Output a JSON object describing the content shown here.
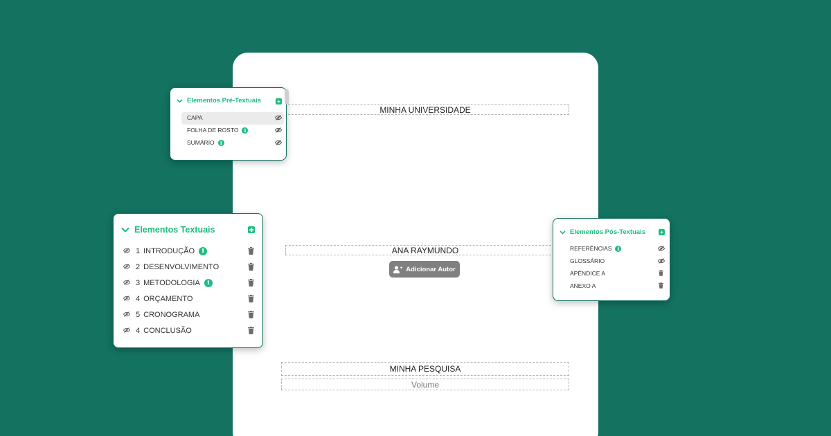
{
  "document": {
    "university": "MINHA UNIVERSIDADE",
    "author": "ANA RAYMUNDO",
    "add_author_label": "Adicionar Autor",
    "title": "MINHA PESQUISA",
    "volume_placeholder": "Volume"
  },
  "pre_textual": {
    "title": "Elementos Pré-Textuais",
    "items": [
      {
        "label": "CAPA",
        "info": false,
        "selected": true
      },
      {
        "label": "FOLHA DE ROSTO",
        "info": true
      },
      {
        "label": "SUMÁRIO",
        "info": true
      }
    ]
  },
  "textual": {
    "title": "Elementos Textuais",
    "items": [
      {
        "number": "1",
        "label": "INTRODUÇÃO",
        "info": true
      },
      {
        "number": "2",
        "label": "DESENVOLVIMENTO",
        "info": false
      },
      {
        "number": "3",
        "label": "METODOLOGIA",
        "info": true
      },
      {
        "number": "4",
        "label": "ORÇAMENTO",
        "info": false
      },
      {
        "number": "5",
        "label": "CRONOGRAMA",
        "info": false
      },
      {
        "number": "4",
        "label": "CONCLUSÃO",
        "info": false
      }
    ]
  },
  "post_textual": {
    "title": "Elementos Pós-Textuais",
    "items": [
      {
        "label": "REFERÊNCIAS",
        "info": true,
        "action": "visibility"
      },
      {
        "label": "GLOSSÁRIO",
        "info": false,
        "action": "visibility"
      },
      {
        "label": "APÊNDICE A",
        "info": false,
        "action": "delete"
      },
      {
        "label": "ANEXO A",
        "info": false,
        "action": "delete"
      }
    ]
  },
  "icons": {
    "info": "i",
    "chevron": "chevron-down-icon",
    "add": "plus-square-icon",
    "visibility": "eye-off-icon",
    "delete": "trash-icon",
    "add_author": "user-plus-icon"
  },
  "colors": {
    "background": "#137260",
    "accent": "#1dbd7f",
    "button_gray": "#808080"
  }
}
